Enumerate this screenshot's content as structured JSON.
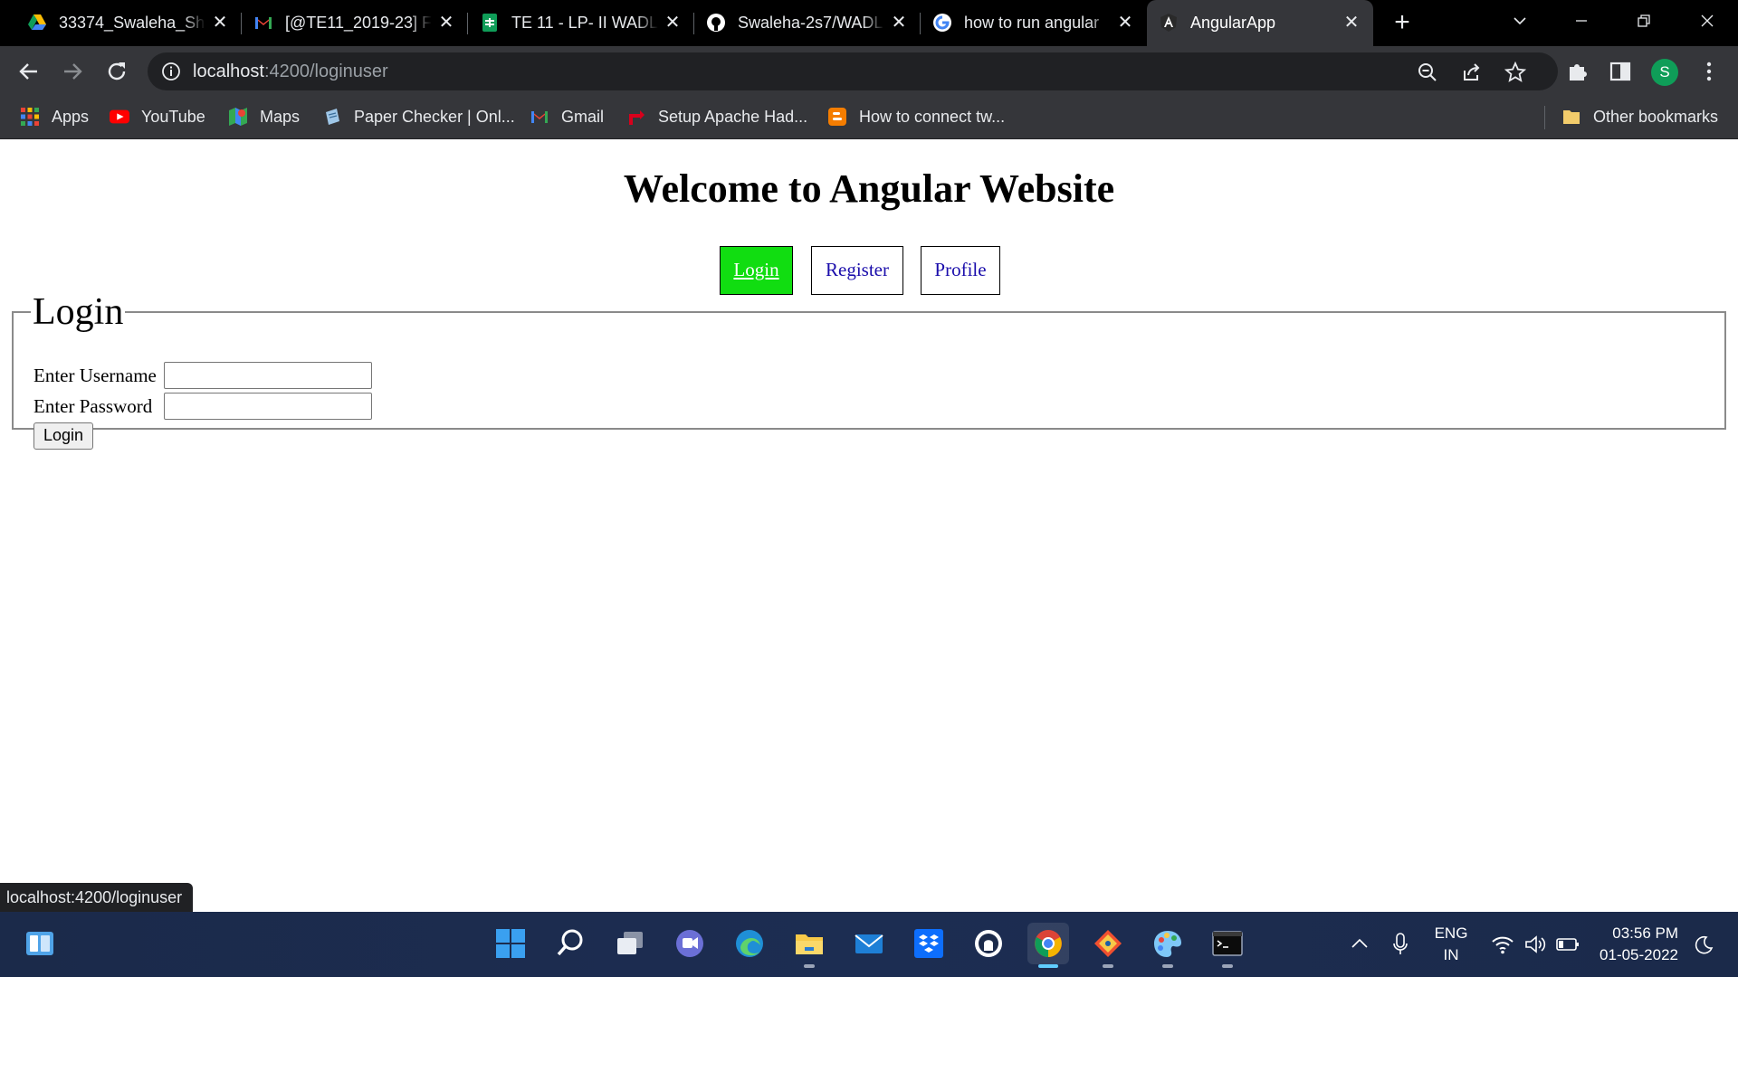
{
  "browser": {
    "tabs": [
      {
        "title": "33374_Swaleha_Sha",
        "icon": "google-drive-icon",
        "active": false
      },
      {
        "title": "[@TE11_2019-23] F",
        "icon": "gmail-icon",
        "active": false
      },
      {
        "title": "TE 11 - LP- II WADL",
        "icon": "google-sheets-icon",
        "active": false
      },
      {
        "title": "Swaleha-2s7/WADL",
        "icon": "github-icon",
        "active": false
      },
      {
        "title": "how to run angular",
        "icon": "google-icon",
        "active": false
      },
      {
        "title": "AngularApp",
        "icon": "angular-icon",
        "active": true
      }
    ],
    "url_host": "localhost",
    "url_path": ":4200/loginuser",
    "profile_initial": "S",
    "bookmarks": [
      {
        "label": "Apps",
        "icon": "apps-grid-icon"
      },
      {
        "label": "YouTube",
        "icon": "youtube-icon"
      },
      {
        "label": "Maps",
        "icon": "maps-icon"
      },
      {
        "label": "Paper Checker | Onl...",
        "icon": "paper-checker-icon"
      },
      {
        "label": "Gmail",
        "icon": "gmail-icon"
      },
      {
        "label": "Setup Apache Had...",
        "icon": "apache-icon"
      },
      {
        "label": "How to connect tw...",
        "icon": "blogger-icon"
      }
    ],
    "other_bookmarks": "Other bookmarks",
    "status_url": "localhost:4200/loginuser"
  },
  "page": {
    "heading": "Welcome to Angular Website",
    "nav": {
      "login": "Login",
      "register": "Register",
      "profile": "Profile"
    },
    "login_form": {
      "legend": "Login",
      "username_label": "Enter Username",
      "password_label": "Enter Password",
      "submit_label": "Login"
    }
  },
  "taskbar": {
    "apps": [
      "start-icon",
      "search-icon",
      "task-view-icon",
      "teams-chat-icon",
      "edge-icon",
      "file-explorer-icon",
      "mail-icon",
      "dropbox-icon",
      "github-desktop-icon",
      "chrome-icon",
      "git-icon",
      "paint-icon",
      "terminal-icon"
    ],
    "language_line1": "ENG",
    "language_line2": "IN",
    "time": "03:56 PM",
    "date": "01-05-2022"
  },
  "colors": {
    "active_nav_bg": "#11dd11",
    "link_color": "#1a0dab",
    "chrome_dark": "#35363a",
    "tab_strip": "#000000"
  }
}
